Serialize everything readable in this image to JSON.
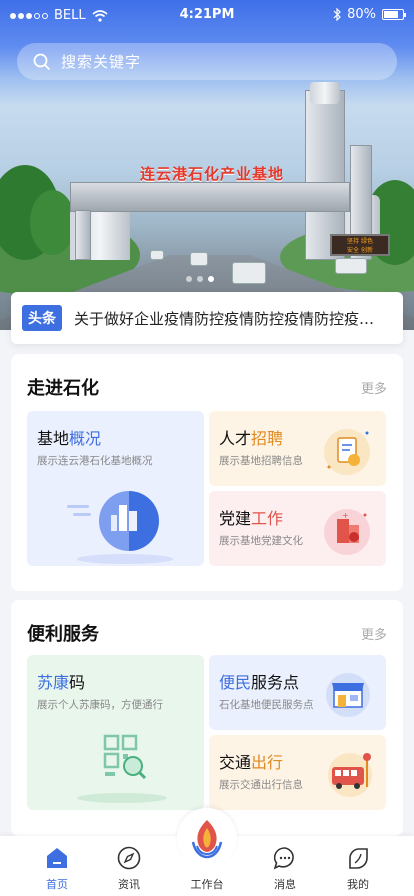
{
  "status_bar": {
    "carrier": "BELL",
    "time": "4:21PM",
    "battery": "80%",
    "battery_level": 0.8
  },
  "search": {
    "placeholder": "搜索关键字"
  },
  "banner": {
    "gate_title": "连云港石化产业基地",
    "led_lines": [
      "坚持 绿色",
      "安全 创新"
    ],
    "slide_count": 3,
    "active_slide": 2
  },
  "news": {
    "badge": "头条",
    "headline": "关于做好企业疫情防控疫情防控疫情防控疫情防控"
  },
  "section_intro": {
    "title": "走进石化",
    "more": "更多",
    "cards": [
      {
        "title_a": "基地",
        "title_b": "概况",
        "desc": "展示连云港石化基地概况"
      },
      {
        "title_a": "人才",
        "title_b": "招聘",
        "desc": "展示基地招聘信息"
      },
      {
        "title_a": "党建",
        "title_b": "工作",
        "desc": "展示基地党建文化"
      }
    ]
  },
  "section_service": {
    "title": "便利服务",
    "more": "更多",
    "cards": [
      {
        "title_a": "苏康",
        "title_b": "码",
        "desc": "展示个人苏康码，方便通行"
      },
      {
        "title_a": "便民",
        "title_b": "服务点",
        "desc": "石化基地便民服务点"
      },
      {
        "title_a": "交通",
        "title_b": "出行",
        "desc": "展示交通出行信息"
      }
    ]
  },
  "tabs": [
    {
      "label": "首页",
      "icon": "home-icon"
    },
    {
      "label": "资讯",
      "icon": "compass-icon"
    },
    {
      "label": "工作台",
      "icon": "flame-logo-icon"
    },
    {
      "label": "消息",
      "icon": "chat-bubble-icon"
    },
    {
      "label": "我的",
      "icon": "leaf-profile-icon"
    }
  ],
  "colors": {
    "accent": "#3d6fe0",
    "orange": "#e08a1f",
    "red": "#e0544a"
  }
}
